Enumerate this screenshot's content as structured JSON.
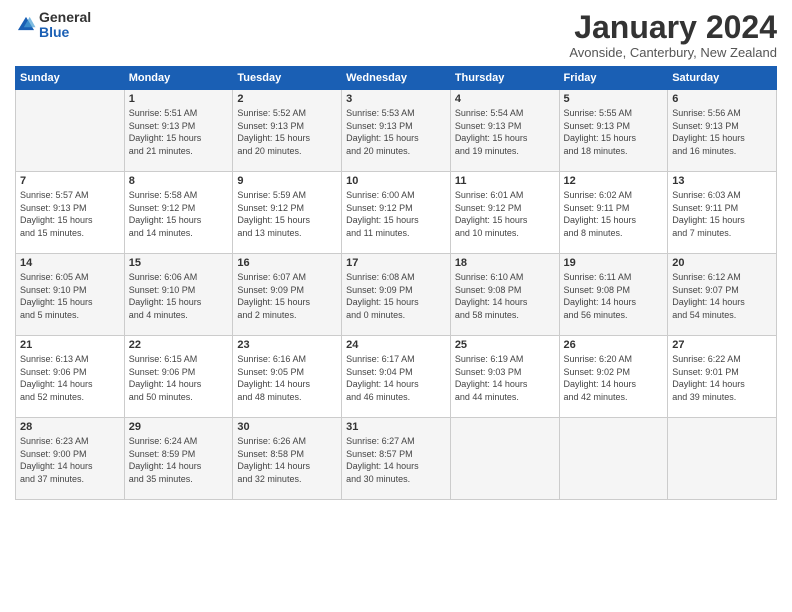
{
  "logo": {
    "general": "General",
    "blue": "Blue"
  },
  "title": "January 2024",
  "location": "Avonside, Canterbury, New Zealand",
  "days_header": [
    "Sunday",
    "Monday",
    "Tuesday",
    "Wednesday",
    "Thursday",
    "Friday",
    "Saturday"
  ],
  "weeks": [
    [
      {
        "day": "",
        "content": ""
      },
      {
        "day": "1",
        "content": "Sunrise: 5:51 AM\nSunset: 9:13 PM\nDaylight: 15 hours\nand 21 minutes."
      },
      {
        "day": "2",
        "content": "Sunrise: 5:52 AM\nSunset: 9:13 PM\nDaylight: 15 hours\nand 20 minutes."
      },
      {
        "day": "3",
        "content": "Sunrise: 5:53 AM\nSunset: 9:13 PM\nDaylight: 15 hours\nand 20 minutes."
      },
      {
        "day": "4",
        "content": "Sunrise: 5:54 AM\nSunset: 9:13 PM\nDaylight: 15 hours\nand 19 minutes."
      },
      {
        "day": "5",
        "content": "Sunrise: 5:55 AM\nSunset: 9:13 PM\nDaylight: 15 hours\nand 18 minutes."
      },
      {
        "day": "6",
        "content": "Sunrise: 5:56 AM\nSunset: 9:13 PM\nDaylight: 15 hours\nand 16 minutes."
      }
    ],
    [
      {
        "day": "7",
        "content": "Sunrise: 5:57 AM\nSunset: 9:13 PM\nDaylight: 15 hours\nand 15 minutes."
      },
      {
        "day": "8",
        "content": "Sunrise: 5:58 AM\nSunset: 9:12 PM\nDaylight: 15 hours\nand 14 minutes."
      },
      {
        "day": "9",
        "content": "Sunrise: 5:59 AM\nSunset: 9:12 PM\nDaylight: 15 hours\nand 13 minutes."
      },
      {
        "day": "10",
        "content": "Sunrise: 6:00 AM\nSunset: 9:12 PM\nDaylight: 15 hours\nand 11 minutes."
      },
      {
        "day": "11",
        "content": "Sunrise: 6:01 AM\nSunset: 9:12 PM\nDaylight: 15 hours\nand 10 minutes."
      },
      {
        "day": "12",
        "content": "Sunrise: 6:02 AM\nSunset: 9:11 PM\nDaylight: 15 hours\nand 8 minutes."
      },
      {
        "day": "13",
        "content": "Sunrise: 6:03 AM\nSunset: 9:11 PM\nDaylight: 15 hours\nand 7 minutes."
      }
    ],
    [
      {
        "day": "14",
        "content": "Sunrise: 6:05 AM\nSunset: 9:10 PM\nDaylight: 15 hours\nand 5 minutes."
      },
      {
        "day": "15",
        "content": "Sunrise: 6:06 AM\nSunset: 9:10 PM\nDaylight: 15 hours\nand 4 minutes."
      },
      {
        "day": "16",
        "content": "Sunrise: 6:07 AM\nSunset: 9:09 PM\nDaylight: 15 hours\nand 2 minutes."
      },
      {
        "day": "17",
        "content": "Sunrise: 6:08 AM\nSunset: 9:09 PM\nDaylight: 15 hours\nand 0 minutes."
      },
      {
        "day": "18",
        "content": "Sunrise: 6:10 AM\nSunset: 9:08 PM\nDaylight: 14 hours\nand 58 minutes."
      },
      {
        "day": "19",
        "content": "Sunrise: 6:11 AM\nSunset: 9:08 PM\nDaylight: 14 hours\nand 56 minutes."
      },
      {
        "day": "20",
        "content": "Sunrise: 6:12 AM\nSunset: 9:07 PM\nDaylight: 14 hours\nand 54 minutes."
      }
    ],
    [
      {
        "day": "21",
        "content": "Sunrise: 6:13 AM\nSunset: 9:06 PM\nDaylight: 14 hours\nand 52 minutes."
      },
      {
        "day": "22",
        "content": "Sunrise: 6:15 AM\nSunset: 9:06 PM\nDaylight: 14 hours\nand 50 minutes."
      },
      {
        "day": "23",
        "content": "Sunrise: 6:16 AM\nSunset: 9:05 PM\nDaylight: 14 hours\nand 48 minutes."
      },
      {
        "day": "24",
        "content": "Sunrise: 6:17 AM\nSunset: 9:04 PM\nDaylight: 14 hours\nand 46 minutes."
      },
      {
        "day": "25",
        "content": "Sunrise: 6:19 AM\nSunset: 9:03 PM\nDaylight: 14 hours\nand 44 minutes."
      },
      {
        "day": "26",
        "content": "Sunrise: 6:20 AM\nSunset: 9:02 PM\nDaylight: 14 hours\nand 42 minutes."
      },
      {
        "day": "27",
        "content": "Sunrise: 6:22 AM\nSunset: 9:01 PM\nDaylight: 14 hours\nand 39 minutes."
      }
    ],
    [
      {
        "day": "28",
        "content": "Sunrise: 6:23 AM\nSunset: 9:00 PM\nDaylight: 14 hours\nand 37 minutes."
      },
      {
        "day": "29",
        "content": "Sunrise: 6:24 AM\nSunset: 8:59 PM\nDaylight: 14 hours\nand 35 minutes."
      },
      {
        "day": "30",
        "content": "Sunrise: 6:26 AM\nSunset: 8:58 PM\nDaylight: 14 hours\nand 32 minutes."
      },
      {
        "day": "31",
        "content": "Sunrise: 6:27 AM\nSunset: 8:57 PM\nDaylight: 14 hours\nand 30 minutes."
      },
      {
        "day": "",
        "content": ""
      },
      {
        "day": "",
        "content": ""
      },
      {
        "day": "",
        "content": ""
      }
    ]
  ]
}
